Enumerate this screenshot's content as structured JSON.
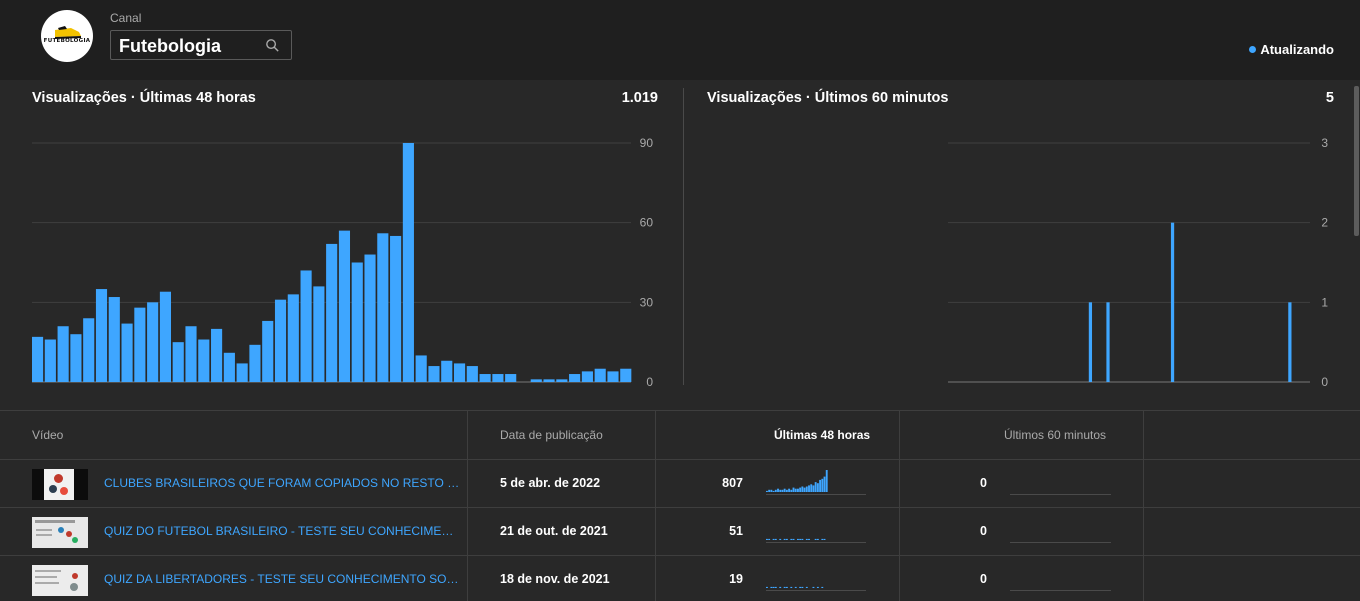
{
  "header": {
    "avatar_text": "FUTEBOLOGIA",
    "channel_label": "Canal",
    "channel_name": "Futebologia",
    "status": "Atualizando",
    "status_color": "#3ea6ff"
  },
  "charts": {
    "left": {
      "title": "Visualizações · Últimas 48 horas",
      "total": "1.019"
    },
    "right": {
      "title": "Visualizações · Últimos 60 minutos",
      "total": "5"
    }
  },
  "chart_data": [
    {
      "type": "bar",
      "title": "Visualizações · Últimas 48 horas",
      "ylim": [
        0,
        90
      ],
      "yticks": [
        0,
        30,
        60,
        90
      ],
      "grid": true,
      "color": "#3ea6ff",
      "values": [
        17,
        16,
        21,
        18,
        24,
        35,
        32,
        22,
        28,
        30,
        34,
        15,
        21,
        16,
        20,
        11,
        7,
        14,
        23,
        31,
        33,
        42,
        36,
        52,
        57,
        45,
        48,
        56,
        55,
        90,
        10,
        6,
        8,
        7,
        6,
        3,
        3,
        3,
        0,
        1,
        1,
        1,
        3,
        4,
        5,
        4,
        5
      ]
    },
    {
      "type": "bar",
      "title": "Visualizações · Últimos 60 minutos",
      "ylim": [
        0,
        3
      ],
      "yticks": [
        0,
        1,
        2,
        3
      ],
      "grid": true,
      "color": "#3ea6ff",
      "values": [
        0,
        0,
        0,
        0,
        0,
        0,
        0,
        0,
        0,
        0,
        0,
        0,
        0,
        0,
        0,
        0,
        0,
        0,
        0,
        0,
        0,
        0,
        0,
        0,
        1,
        0,
        0,
        1,
        0,
        0,
        0,
        0,
        0,
        0,
        0,
        0,
        0,
        0,
        2,
        0,
        0,
        0,
        0,
        0,
        0,
        0,
        0,
        0,
        0,
        0,
        0,
        0,
        0,
        0,
        0,
        0,
        0,
        0,
        1,
        0
      ]
    }
  ],
  "table": {
    "headers": {
      "video": "Vídeo",
      "date": "Data de publicação",
      "last48": "Últimas 48 horas",
      "last60": "Últimos 60 minutos"
    },
    "rows": [
      {
        "title": "CLUBES BRASILEIROS QUE FORAM COPIADOS NO RESTO DO MUNDO",
        "date": "5 de abr. de 2022",
        "views48": "807",
        "views60": "0",
        "spark": [
          1,
          2,
          2,
          1,
          2,
          3,
          2,
          2,
          3,
          2,
          3,
          2,
          4,
          3,
          3,
          4,
          5,
          4,
          5,
          6,
          7,
          6,
          9,
          8,
          11,
          12,
          14,
          20
        ]
      },
      {
        "title": "QUIZ DO FUTEBOL BRASILEIRO - TESTE SEU CONHECIMENTO SOBRE FUTEBOL",
        "date": "21 de out. de 2021",
        "views48": "51",
        "views60": "0",
        "spark": [
          1,
          1,
          0,
          1,
          1,
          0,
          1,
          0,
          1,
          1,
          0,
          1,
          1,
          0,
          1,
          1,
          1,
          0,
          1,
          1,
          0,
          0,
          1,
          1,
          0,
          1,
          1,
          0
        ]
      },
      {
        "title": "QUIZ DA LIBERTADORES - TESTE SEU CONHECIMENTO SOBRE A LIBERTADORES",
        "date": "18 de nov. de 2021",
        "views48": "19",
        "views60": "0",
        "spark": [
          1,
          0,
          1,
          1,
          1,
          0,
          1,
          0,
          1,
          1,
          0,
          1,
          0,
          1,
          0,
          1,
          1,
          0,
          1,
          0,
          0,
          1,
          0,
          1,
          0,
          1,
          0,
          0
        ]
      }
    ]
  }
}
